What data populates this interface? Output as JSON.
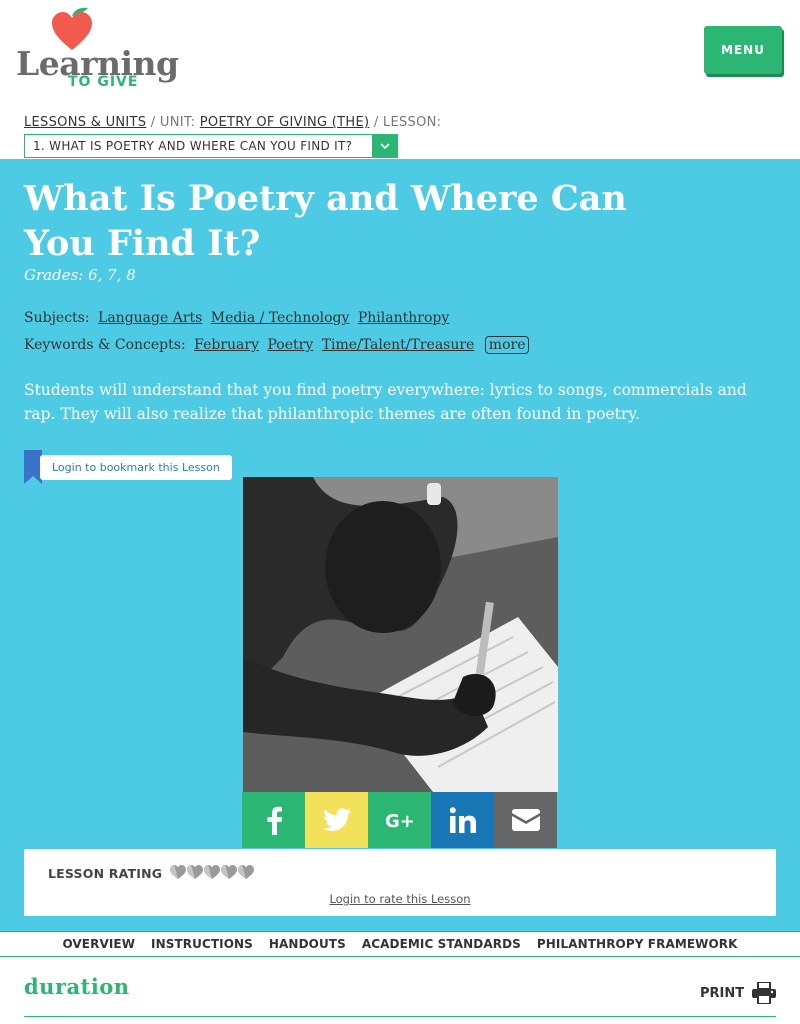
{
  "logo": {
    "word": "Learning",
    "tagline": "TO GIVE"
  },
  "header": {
    "menu_label": "MENU"
  },
  "breadcrumb": {
    "lessons_units": "LESSONS & UNITS",
    "sep1": " / UNIT: ",
    "unit": "POETRY OF GIVING (THE)",
    "sep2": " / LESSON:",
    "lesson_select": "1. WHAT IS POETRY AND WHERE CAN YOU FIND IT?"
  },
  "lesson": {
    "title": "What Is Poetry and Where Can You Find It?",
    "grades": "Grades: 6, 7, 8",
    "subjects_label": "Subjects:",
    "subjects": [
      "Language Arts",
      "Media / Technology",
      "Philanthropy"
    ],
    "keywords_label": "Keywords & Concepts:",
    "keywords": [
      "February",
      "Poetry",
      "Time/Talent/Treasure"
    ],
    "more_label": "more",
    "summary": "Students will understand that you find poetry everywhere: lyrics to songs, commercials and rap. They will also realize that philanthropic themes are often found in poetry.",
    "bookmark_label": "Login to bookmark this Lesson"
  },
  "share": {
    "icons": [
      "facebook-icon",
      "twitter-icon",
      "google-plus-icon",
      "linkedin-icon",
      "email-icon"
    ],
    "colors": [
      "#2bb673",
      "#f2e15a",
      "#2bb673",
      "#1877b4",
      "#666666"
    ]
  },
  "rating": {
    "label": "LESSON RATING",
    "hearts_filled": 0,
    "hearts_total": 5,
    "login_label": "Login to rate this Lesson"
  },
  "tabs": [
    "OVERVIEW",
    "INSTRUCTIONS",
    "HANDOUTS",
    "ACADEMIC STANDARDS",
    "PHILANTHROPY FRAMEWORK"
  ],
  "section": {
    "heading": "duration",
    "print_label": "PRINT"
  },
  "colors": {
    "accent": "#2bb673",
    "hero": "#4ecbe4",
    "link_blue": "#2b7bb9"
  }
}
